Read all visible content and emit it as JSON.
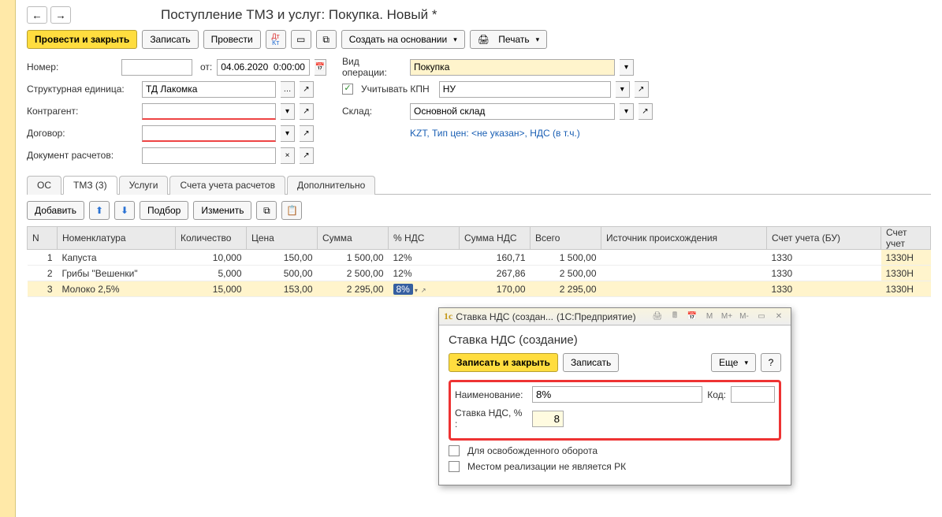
{
  "title": "Поступление ТМЗ и услуг: Покупка. Новый *",
  "toolbar": {
    "post_close": "Провести и закрыть",
    "write": "Записать",
    "post": "Провести",
    "create_based": "Создать на основании",
    "print": "Печать"
  },
  "labels": {
    "number": "Номер:",
    "from": "от:",
    "date_value": "04.06.2020  0:00:00",
    "struct_unit": "Структурная единица:",
    "struct_unit_value": "ТД Лакомка",
    "counterparty": "Контрагент:",
    "contract": "Договор:",
    "settlement_doc": "Документ расчетов:",
    "operation_type": "Вид операции:",
    "operation_value": "Покупка",
    "consider_kpn": "Учитывать КПН",
    "kpn_value": "НУ",
    "warehouse": "Склад:",
    "warehouse_value": "Основной склад",
    "prices_link": "KZT, Тип цен: <не указан>, НДС (в т.ч.)"
  },
  "tabs": {
    "os": "ОС",
    "tmz": "ТМЗ (3)",
    "services": "Услуги",
    "accounts": "Счета учета расчетов",
    "additional": "Дополнительно"
  },
  "subtoolbar": {
    "add": "Добавить",
    "pick": "Подбор",
    "change": "Изменить"
  },
  "columns": {
    "n": "N",
    "item": "Номенклатура",
    "qty": "Количество",
    "price": "Цена",
    "sum": "Сумма",
    "vat": "% НДС",
    "vat_sum": "Сумма НДС",
    "total": "Всего",
    "origin": "Источник происхождения",
    "acc_bu": "Счет учета (БУ)",
    "acc_tax": "Счет учет"
  },
  "rows": [
    {
      "n": "1",
      "item": "Капуста",
      "qty": "10,000",
      "price": "150,00",
      "sum": "1 500,00",
      "vat": "12%",
      "vat_sum": "160,71",
      "total": "1 500,00",
      "acc_bu": "1330",
      "acc_tax": "1330Н"
    },
    {
      "n": "2",
      "item": "Грибы \"Вешенки\"",
      "qty": "5,000",
      "price": "500,00",
      "sum": "2 500,00",
      "vat": "12%",
      "vat_sum": "267,86",
      "total": "2 500,00",
      "acc_bu": "1330",
      "acc_tax": "1330Н"
    },
    {
      "n": "3",
      "item": "Молоко 2,5%",
      "qty": "15,000",
      "price": "153,00",
      "sum": "2 295,00",
      "vat": "8%",
      "vat_sum": "170,00",
      "total": "2 295,00",
      "acc_bu": "1330",
      "acc_tax": "1330Н"
    }
  ],
  "dialog": {
    "window_title": "Ставка НДС (создан...",
    "app_name": "(1С:Предприятие)",
    "heading": "Ставка НДС (создание)",
    "write_close": "Записать и закрыть",
    "write": "Записать",
    "more": "Еще",
    "name_label": "Наименование:",
    "name_value": "8%",
    "code_label": "Код:",
    "rate_label": "Ставка НДС, % :",
    "rate_value": "8",
    "chk1": "Для освобожденного оборота",
    "chk2": "Местом реализации не является РК"
  }
}
